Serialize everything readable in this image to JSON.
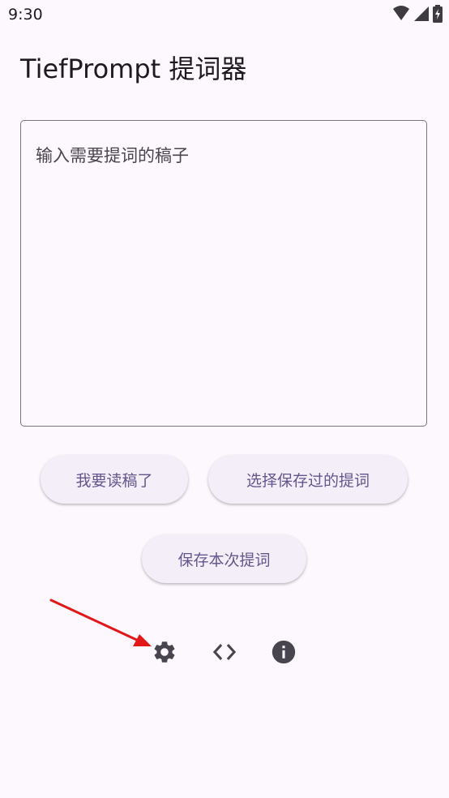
{
  "status_bar": {
    "time": "9:30",
    "icons": [
      "wifi-icon",
      "signal-icon",
      "battery-icon"
    ]
  },
  "app": {
    "title": "TiefPrompt 提词器"
  },
  "editor": {
    "placeholder": "输入需要提词的稿子",
    "value": ""
  },
  "buttons": {
    "read": "我要读稿了",
    "select_saved": "选择保存过的提词",
    "save_current": "保存本次提词"
  },
  "toolbar_icons": [
    "settings-icon",
    "code-icon",
    "info-icon"
  ],
  "colors": {
    "background": "#fdf7fe",
    "button_bg": "#f4eef8",
    "button_text": "#65558f",
    "icon": "#49454f",
    "annotation_arrow": "#e01818"
  }
}
